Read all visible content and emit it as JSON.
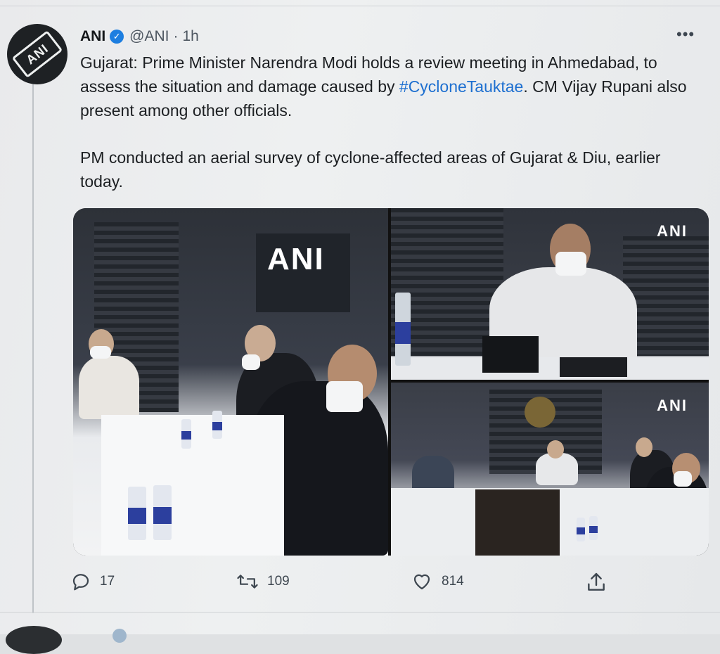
{
  "tweet": {
    "author_name": "ANI",
    "handle": "@ANI",
    "separator": "·",
    "time": "1h",
    "verified_mark": "✓",
    "more_label": "•••",
    "avatar_text": "ANI",
    "text_line1_prefix": "Gujarat: Prime Minister Narendra Modi holds a review meeting in Ahmedabad, to assess the situation and damage caused by ",
    "hashtag": "#CycloneTauktae",
    "text_line1_suffix": ". CM Vijay Rupani also present among other officials.",
    "text_paragraph2": "PM conducted an aerial survey of cyclone-affected areas of Gujarat & Diu, earlier today."
  },
  "media": {
    "watermarks": [
      "ANI",
      "ANI",
      "ANI"
    ]
  },
  "actions": {
    "reply_count": "17",
    "retweet_count": "109",
    "like_count": "814"
  },
  "icons": {
    "avatar": "ani-microphone-logo",
    "verified": "verified-badge-icon",
    "more": "more-options-icon",
    "reply": "reply-icon",
    "retweet": "retweet-icon",
    "like": "heart-icon",
    "share": "share-icon"
  },
  "colors": {
    "link": "#1d6fd0",
    "verified": "#1d7ee0",
    "background": "#eceef0"
  }
}
